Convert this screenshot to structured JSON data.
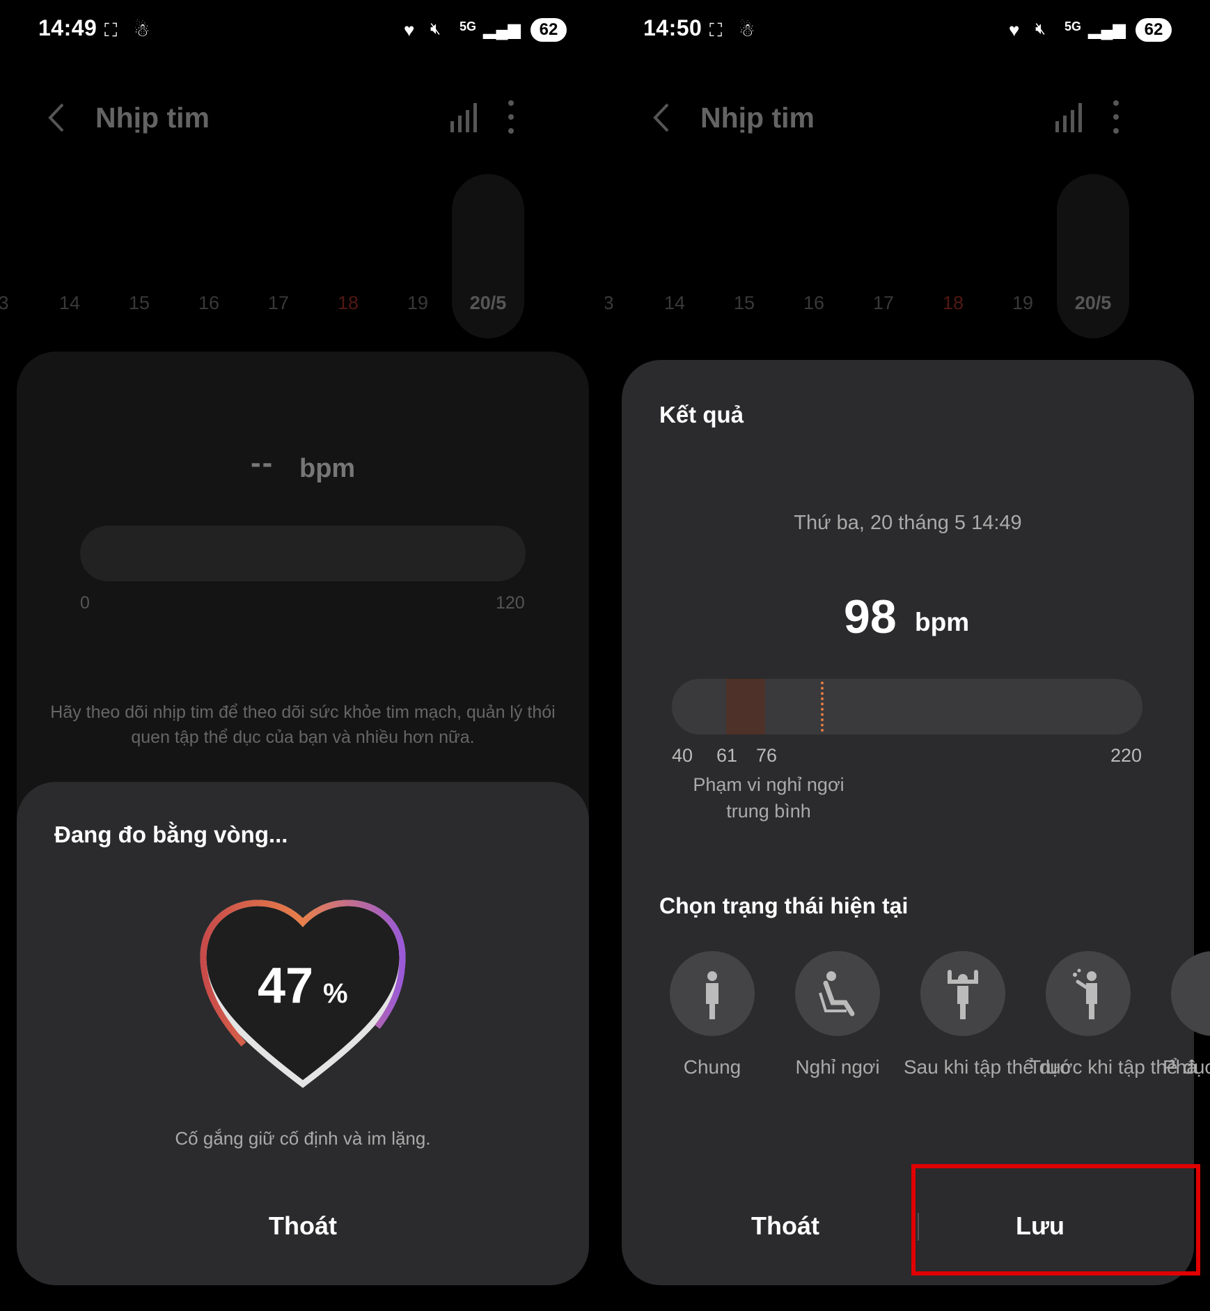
{
  "screens": [
    {
      "status": {
        "time": "14:49",
        "battery": "62"
      },
      "header": {
        "title": "Nhịp tim"
      },
      "dates": [
        "3",
        "14",
        "15",
        "16",
        "17",
        "18",
        "19",
        "20/5"
      ],
      "bpm_placeholder": "--",
      "bpm_unit": "bpm",
      "bar_min": "0",
      "bar_max": "120",
      "description": "Hãy theo dõi nhịp tim để theo dõi sức khỏe tim mạch, quản lý thói quen tập thể dục của bạn và nhiều hơn nữa.",
      "sheet": {
        "title": "Đang đo bằng vòng...",
        "progress": "47",
        "progress_unit": "%",
        "hint": "Cố gắng giữ cố định và im lặng.",
        "exit_label": "Thoát"
      }
    },
    {
      "status": {
        "time": "14:50",
        "battery": "62"
      },
      "header": {
        "title": "Nhịp tim"
      },
      "dates": [
        "3",
        "14",
        "15",
        "16",
        "17",
        "18",
        "19",
        "20/5"
      ],
      "result": {
        "title": "Kết quả",
        "datetime": "Thứ ba, 20 tháng 5 14:49",
        "value": "98",
        "unit": "bpm",
        "scale": [
          "40",
          "61",
          "76",
          "220"
        ],
        "range_caption": "Phạm vi nghỉ ngơi trung bình"
      },
      "state": {
        "title": "Chọn trạng thái hiện tại",
        "options": [
          "Chung",
          "Nghỉ ngơi",
          "Sau khi tập thể dục",
          "Trước khi tập thể dục",
          "Phâ"
        ]
      },
      "exit_label": "Thoát",
      "save_label": "Lưu"
    }
  ],
  "colors": {
    "accent_red": "#c0392b",
    "highlight": "#e00000",
    "range_band": "#4e3128",
    "marker": "#e07b45"
  }
}
